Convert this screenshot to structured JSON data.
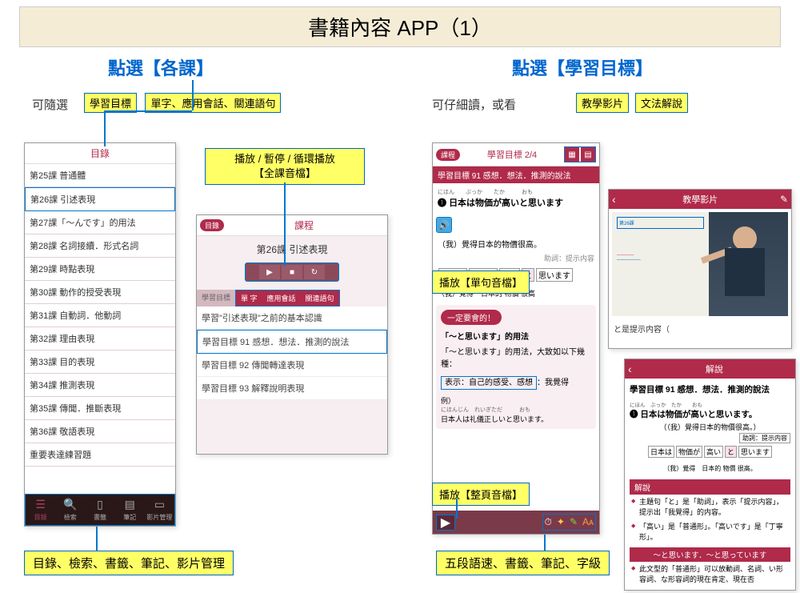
{
  "page_title": "書籍內容 APP（1）",
  "left": {
    "heading": "點選【各課】",
    "note": "可隨選",
    "tag_goal": "學習目標",
    "tag_vocab": "單字、應用會話、關連語句",
    "box_play": "播放 / 暫停 / 循環播放\n【全課音檔】",
    "bottom": "目錄、檢索、書籤、筆記、影片管理"
  },
  "right": {
    "heading": "點選【學習目標】",
    "note": "可仔細讀，或看",
    "tag_video": "教學影片",
    "tag_grammar": "文法解說",
    "tag_sentence": "播放【單句音檔】",
    "tag_page": "播放【整頁音檔】",
    "bottom": "五段語速、書籤、筆記、字級"
  },
  "phone1": {
    "title": "目錄",
    "items": [
      "第25課 普通體",
      "第26課 引述表現",
      "第27課「～んです」的用法",
      "第28課 名詞接續．形式名詞",
      "第29課 時點表現",
      "第30課 動作的授受表現",
      "第31課 自動詞．他動詞",
      "第32課 理由表現",
      "第33課 目的表現",
      "第34課 推測表現",
      "第35課 傳聞．推斷表現",
      "第36課 敬語表現",
      "重要表達練習題"
    ],
    "tabs": [
      "目錄",
      "檢索",
      "書籤",
      "筆記",
      "影片管理"
    ]
  },
  "phone2": {
    "badge": "目錄",
    "title": "課程",
    "subtitle": "第26課 引述表現",
    "tab_goal": "學習目標",
    "tab_vocab": "單 字",
    "tab_conv": "應用會話",
    "tab_rel": "關連語句",
    "rows": [
      "學習\"引述表現\"之前的基本認識",
      "學習目標 91 感想．想法．推測的說法",
      "學習目標 92 傳聞轉達表現",
      "學習目標 93 解釋說明表現"
    ]
  },
  "phone3": {
    "badge": "課程",
    "title": "學習目標 2/4",
    "sub": "學習目標 91 感想．想法．推測的說法",
    "num": "❶",
    "ruby": "にほん　　ぶっか　　たか　　　おも",
    "sentence": "日本は物価が高いと思います",
    "trans": "（我）覺得日本的物價很高。",
    "hint": "助詞：提示内容",
    "seg": [
      "日本は",
      "物価が",
      "高い",
      "と",
      "思います"
    ],
    "seg2": "（我）覺得　日本的 物價 很高",
    "pink_title": "一定要會的！",
    "pink_head": "「～と思います」的用法",
    "pink_body": "「～と思います」的用法，大致如以下幾種：",
    "pink_sel": "表示：自己的感受、感想",
    "pink_after": "：我覺得",
    "ex_label": "例）",
    "ex_ruby": "にほんじん　れいぎただ　　　おも",
    "ex": "日本人は礼儀正しいと思います。"
  },
  "phone4": {
    "title": "教學影片",
    "caption": "と是提示内容（"
  },
  "phone5": {
    "title": "解說",
    "head": "學習目標 91 感想．想法．推測的說法",
    "num": "❶",
    "ruby": "にほん　ぶっか　たか　　おも",
    "sentence": "日本は物価が高いと思います。",
    "trans": "（（我）覺得日本的物價很高。）",
    "hint": "助詞：提示内容",
    "seg": [
      "日本は",
      "物価が",
      "高い",
      "と",
      "思います"
    ],
    "seg2": "（我）覺得　日本的 物價 很高。",
    "sec": "解說",
    "b1": "主題句「と」是「助詞」，表示「提示内容」，提示出「我覺得」的内容。",
    "b2": "「高い」是「普通形」。「高いです」是「丁寧形」。",
    "band": "～と思います．～と思っています",
    "b3": "此文型的「普通形」可以放動詞、名詞、い形容詞、な形容詞的現在肯定、現在否"
  }
}
